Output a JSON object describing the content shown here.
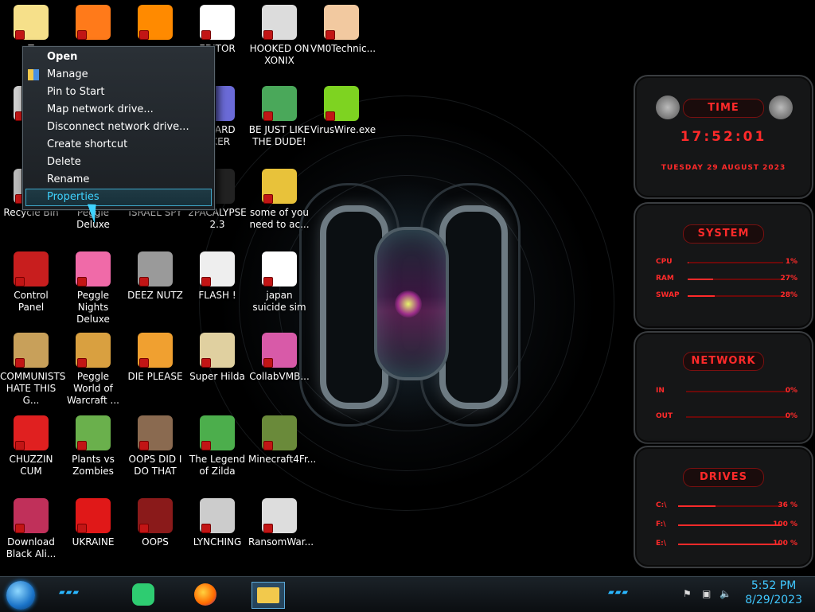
{
  "desktop": {
    "icons": [
      {
        "label": "T",
        "col": 0,
        "row": 0,
        "kind": "cartoon",
        "color": "#f6e08a"
      },
      {
        "label": "",
        "col": 1,
        "row": 0,
        "kind": "firefox",
        "color": "#ff7a1a"
      },
      {
        "label": "",
        "col": 2,
        "row": 0,
        "kind": "vlc",
        "color": "#ff8a00"
      },
      {
        "label": "EDITOR",
        "col": 3,
        "row": 0,
        "kind": "hxd",
        "color": "#ffffff"
      },
      {
        "label": "HOOKED ON XONIX",
        "col": 4,
        "row": 0,
        "kind": "maze",
        "color": "#dcdcdc"
      },
      {
        "label": "VM0Technic...",
        "col": 5,
        "row": 0,
        "kind": "doctor",
        "color": "#f2c9a0"
      },
      {
        "label": "N",
        "col": 0,
        "row": 1,
        "kind": "net",
        "color": "#cfcfcf"
      },
      {
        "label": "T CARD CKER",
        "col": 3,
        "row": 1,
        "kind": "card",
        "color": "#6b6bd8"
      },
      {
        "label": "BE JUST LIKE THE DUDE!",
        "col": 4,
        "row": 1,
        "kind": "elf",
        "color": "#4aa85a"
      },
      {
        "label": "VirusWire.exe",
        "col": 5,
        "row": 1,
        "kind": "lime",
        "color": "#7ed321"
      },
      {
        "label": "Recycle Bin",
        "col": 0,
        "row": 2,
        "kind": "bin",
        "color": "#bbbbbb"
      },
      {
        "label": "Peggle Deluxe",
        "col": 1,
        "row": 2,
        "kind": "peggle",
        "color": "#f5a623"
      },
      {
        "label": "ISRAEL SPY",
        "col": 2,
        "row": 2,
        "kind": "blank",
        "color": "#000000"
      },
      {
        "label": "2PACALYPSE 2.3",
        "col": 3,
        "row": 2,
        "kind": "cmd",
        "color": "#222222"
      },
      {
        "label": "some of you need to ac...",
        "col": 4,
        "row": 2,
        "kind": "dog",
        "color": "#e8c23a"
      },
      {
        "label": "Control Panel",
        "col": 0,
        "row": 3,
        "kind": "cpanel",
        "color": "#c81e1e"
      },
      {
        "label": "Peggle Nights Deluxe",
        "col": 1,
        "row": 3,
        "kind": "peggle",
        "color": "#f06aa8"
      },
      {
        "label": "DEEZ NUTZ",
        "col": 2,
        "row": 3,
        "kind": "stack",
        "color": "#9a9a9a"
      },
      {
        "label": "FLASH !",
        "col": 3,
        "row": 3,
        "kind": "flash",
        "color": "#eeeeee"
      },
      {
        "label": "japan suicide sim",
        "col": 4,
        "row": 3,
        "kind": "doc",
        "color": "#ffffff"
      },
      {
        "label": "COMMUNISTS HATE THIS G...",
        "col": 0,
        "row": 4,
        "kind": "money",
        "color": "#c8a05a"
      },
      {
        "label": "Peggle World of Warcraft ...",
        "col": 1,
        "row": 4,
        "kind": "peggle",
        "color": "#d9a040"
      },
      {
        "label": "DIE PLEASE",
        "col": 2,
        "row": 4,
        "kind": "de",
        "color": "#f0a030"
      },
      {
        "label": "Super Hilda",
        "col": 3,
        "row": 4,
        "kind": "pixel",
        "color": "#e0d0a0"
      },
      {
        "label": "CollabVMB...",
        "col": 4,
        "row": 4,
        "kind": "cube",
        "color": "#d85aa8"
      },
      {
        "label": "CHUZZIN CUM",
        "col": 0,
        "row": 5,
        "kind": "chuzzle",
        "color": "#e02020"
      },
      {
        "label": "Plants vs Zombies",
        "col": 1,
        "row": 5,
        "kind": "pvz",
        "color": "#6ab04c"
      },
      {
        "label": "OOPS DID I DO THAT",
        "col": 2,
        "row": 5,
        "kind": "portrait",
        "color": "#8a6a50"
      },
      {
        "label": "The Legend of Zilda",
        "col": 3,
        "row": 5,
        "kind": "zelda",
        "color": "#4cae4c"
      },
      {
        "label": "Minecraft4Fr...",
        "col": 4,
        "row": 5,
        "kind": "grass",
        "color": "#6a8a3a"
      },
      {
        "label": "Download Black Ali...",
        "col": 0,
        "row": 6,
        "kind": "alien",
        "color": "#c0305a"
      },
      {
        "label": "UKRAINE",
        "col": 1,
        "row": 6,
        "kind": "radiation",
        "color": "#e01818"
      },
      {
        "label": "OOPS",
        "col": 2,
        "row": 6,
        "kind": "red-pc",
        "color": "#8a1a1a"
      },
      {
        "label": "LYNCHING",
        "col": 3,
        "row": 6,
        "kind": "web",
        "color": "#cccccc"
      },
      {
        "label": "RansomWar...",
        "col": 4,
        "row": 6,
        "kind": "skull",
        "color": "#dddddd"
      }
    ]
  },
  "context_menu": {
    "items": [
      {
        "label": "Open",
        "bold": true,
        "highlight": false,
        "icon": ""
      },
      {
        "label": "Manage",
        "bold": false,
        "highlight": false,
        "icon": "manage-icon"
      },
      {
        "label": "Pin to Start",
        "bold": false,
        "highlight": false,
        "icon": ""
      },
      {
        "label": "Map network drive...",
        "bold": false,
        "highlight": false,
        "icon": ""
      },
      {
        "label": "Disconnect network drive...",
        "bold": false,
        "highlight": false,
        "icon": ""
      },
      {
        "label": "Create shortcut",
        "bold": false,
        "highlight": false,
        "icon": ""
      },
      {
        "label": "Delete",
        "bold": false,
        "highlight": false,
        "icon": ""
      },
      {
        "label": "Rename",
        "bold": false,
        "highlight": false,
        "icon": ""
      },
      {
        "label": "Properties",
        "bold": false,
        "highlight": true,
        "icon": ""
      }
    ]
  },
  "widgets": {
    "time": {
      "title": "TIME",
      "clock": "17:52:01",
      "date": "TUESDAY 29 AUGUST 2023"
    },
    "system": {
      "title": "SYSTEM",
      "rows": [
        {
          "label": "CPU",
          "value": "1%",
          "level": 0.01
        },
        {
          "label": "RAM",
          "value": "27%",
          "level": 0.27
        },
        {
          "label": "SWAP",
          "value": "28%",
          "level": 0.28
        }
      ]
    },
    "network": {
      "title": "NETWORK",
      "rows": [
        {
          "label": "IN",
          "value": "0%"
        },
        {
          "label": "OUT",
          "value": "0%"
        }
      ]
    },
    "drives": {
      "title": "DRIVES",
      "rows": [
        {
          "label": "C:\\",
          "value": "36 %",
          "level": 0.36
        },
        {
          "label": "F:\\",
          "value": "100 %",
          "level": 1.0
        },
        {
          "label": "E:\\",
          "value": "100 %",
          "level": 1.0
        }
      ]
    }
  },
  "taskbar": {
    "clock_time": "5:52 PM",
    "clock_date": "8/29/2023",
    "apps": [
      "chat-app-icon",
      "firefox-icon",
      "file-explorer-icon"
    ],
    "accent": "#2ab7ff"
  }
}
